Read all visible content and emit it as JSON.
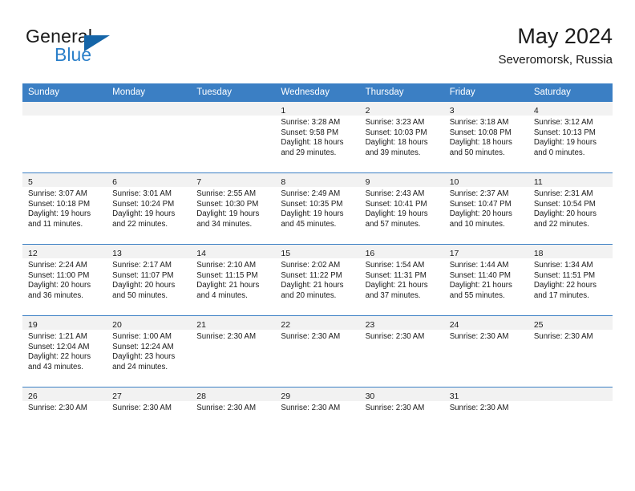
{
  "brand": {
    "name_top": "General",
    "name_bottom": "Blue",
    "triangle_color": "#1565a8",
    "blue_color": "#2a7fc9"
  },
  "header": {
    "title": "May 2024",
    "subtitle": "Severomorsk, Russia"
  },
  "theme": {
    "header_bg": "#3b7fc4",
    "header_text": "#ffffff",
    "daynum_band_bg": "#f2f2f2",
    "cell_bg": "#ffffff",
    "row_border": "#3b7fc4"
  },
  "weekdays": [
    "Sunday",
    "Monday",
    "Tuesday",
    "Wednesday",
    "Thursday",
    "Friday",
    "Saturday"
  ],
  "weeks": [
    [
      {
        "day": "",
        "lines": []
      },
      {
        "day": "",
        "lines": []
      },
      {
        "day": "",
        "lines": []
      },
      {
        "day": "1",
        "lines": [
          "Sunrise: 3:28 AM",
          "Sunset: 9:58 PM",
          "Daylight: 18 hours",
          "and 29 minutes."
        ]
      },
      {
        "day": "2",
        "lines": [
          "Sunrise: 3:23 AM",
          "Sunset: 10:03 PM",
          "Daylight: 18 hours",
          "and 39 minutes."
        ]
      },
      {
        "day": "3",
        "lines": [
          "Sunrise: 3:18 AM",
          "Sunset: 10:08 PM",
          "Daylight: 18 hours",
          "and 50 minutes."
        ]
      },
      {
        "day": "4",
        "lines": [
          "Sunrise: 3:12 AM",
          "Sunset: 10:13 PM",
          "Daylight: 19 hours",
          "and 0 minutes."
        ]
      }
    ],
    [
      {
        "day": "5",
        "lines": [
          "Sunrise: 3:07 AM",
          "Sunset: 10:18 PM",
          "Daylight: 19 hours",
          "and 11 minutes."
        ]
      },
      {
        "day": "6",
        "lines": [
          "Sunrise: 3:01 AM",
          "Sunset: 10:24 PM",
          "Daylight: 19 hours",
          "and 22 minutes."
        ]
      },
      {
        "day": "7",
        "lines": [
          "Sunrise: 2:55 AM",
          "Sunset: 10:30 PM",
          "Daylight: 19 hours",
          "and 34 minutes."
        ]
      },
      {
        "day": "8",
        "lines": [
          "Sunrise: 2:49 AM",
          "Sunset: 10:35 PM",
          "Daylight: 19 hours",
          "and 45 minutes."
        ]
      },
      {
        "day": "9",
        "lines": [
          "Sunrise: 2:43 AM",
          "Sunset: 10:41 PM",
          "Daylight: 19 hours",
          "and 57 minutes."
        ]
      },
      {
        "day": "10",
        "lines": [
          "Sunrise: 2:37 AM",
          "Sunset: 10:47 PM",
          "Daylight: 20 hours",
          "and 10 minutes."
        ]
      },
      {
        "day": "11",
        "lines": [
          "Sunrise: 2:31 AM",
          "Sunset: 10:54 PM",
          "Daylight: 20 hours",
          "and 22 minutes."
        ]
      }
    ],
    [
      {
        "day": "12",
        "lines": [
          "Sunrise: 2:24 AM",
          "Sunset: 11:00 PM",
          "Daylight: 20 hours",
          "and 36 minutes."
        ]
      },
      {
        "day": "13",
        "lines": [
          "Sunrise: 2:17 AM",
          "Sunset: 11:07 PM",
          "Daylight: 20 hours",
          "and 50 minutes."
        ]
      },
      {
        "day": "14",
        "lines": [
          "Sunrise: 2:10 AM",
          "Sunset: 11:15 PM",
          "Daylight: 21 hours",
          "and 4 minutes."
        ]
      },
      {
        "day": "15",
        "lines": [
          "Sunrise: 2:02 AM",
          "Sunset: 11:22 PM",
          "Daylight: 21 hours",
          "and 20 minutes."
        ]
      },
      {
        "day": "16",
        "lines": [
          "Sunrise: 1:54 AM",
          "Sunset: 11:31 PM",
          "Daylight: 21 hours",
          "and 37 minutes."
        ]
      },
      {
        "day": "17",
        "lines": [
          "Sunrise: 1:44 AM",
          "Sunset: 11:40 PM",
          "Daylight: 21 hours",
          "and 55 minutes."
        ]
      },
      {
        "day": "18",
        "lines": [
          "Sunrise: 1:34 AM",
          "Sunset: 11:51 PM",
          "Daylight: 22 hours",
          "and 17 minutes."
        ]
      }
    ],
    [
      {
        "day": "19",
        "lines": [
          "Sunrise: 1:21 AM",
          "Sunset: 12:04 AM",
          "Daylight: 22 hours",
          "and 43 minutes."
        ]
      },
      {
        "day": "20",
        "lines": [
          "Sunrise: 1:00 AM",
          "Sunset: 12:24 AM",
          "Daylight: 23 hours",
          "and 24 minutes."
        ]
      },
      {
        "day": "21",
        "lines": [
          "Sunrise: 2:30 AM"
        ]
      },
      {
        "day": "22",
        "lines": [
          "Sunrise: 2:30 AM"
        ]
      },
      {
        "day": "23",
        "lines": [
          "Sunrise: 2:30 AM"
        ]
      },
      {
        "day": "24",
        "lines": [
          "Sunrise: 2:30 AM"
        ]
      },
      {
        "day": "25",
        "lines": [
          "Sunrise: 2:30 AM"
        ]
      }
    ],
    [
      {
        "day": "26",
        "lines": [
          "Sunrise: 2:30 AM"
        ]
      },
      {
        "day": "27",
        "lines": [
          "Sunrise: 2:30 AM"
        ]
      },
      {
        "day": "28",
        "lines": [
          "Sunrise: 2:30 AM"
        ]
      },
      {
        "day": "29",
        "lines": [
          "Sunrise: 2:30 AM"
        ]
      },
      {
        "day": "30",
        "lines": [
          "Sunrise: 2:30 AM"
        ]
      },
      {
        "day": "31",
        "lines": [
          "Sunrise: 2:30 AM"
        ]
      },
      {
        "day": "",
        "lines": []
      }
    ]
  ]
}
